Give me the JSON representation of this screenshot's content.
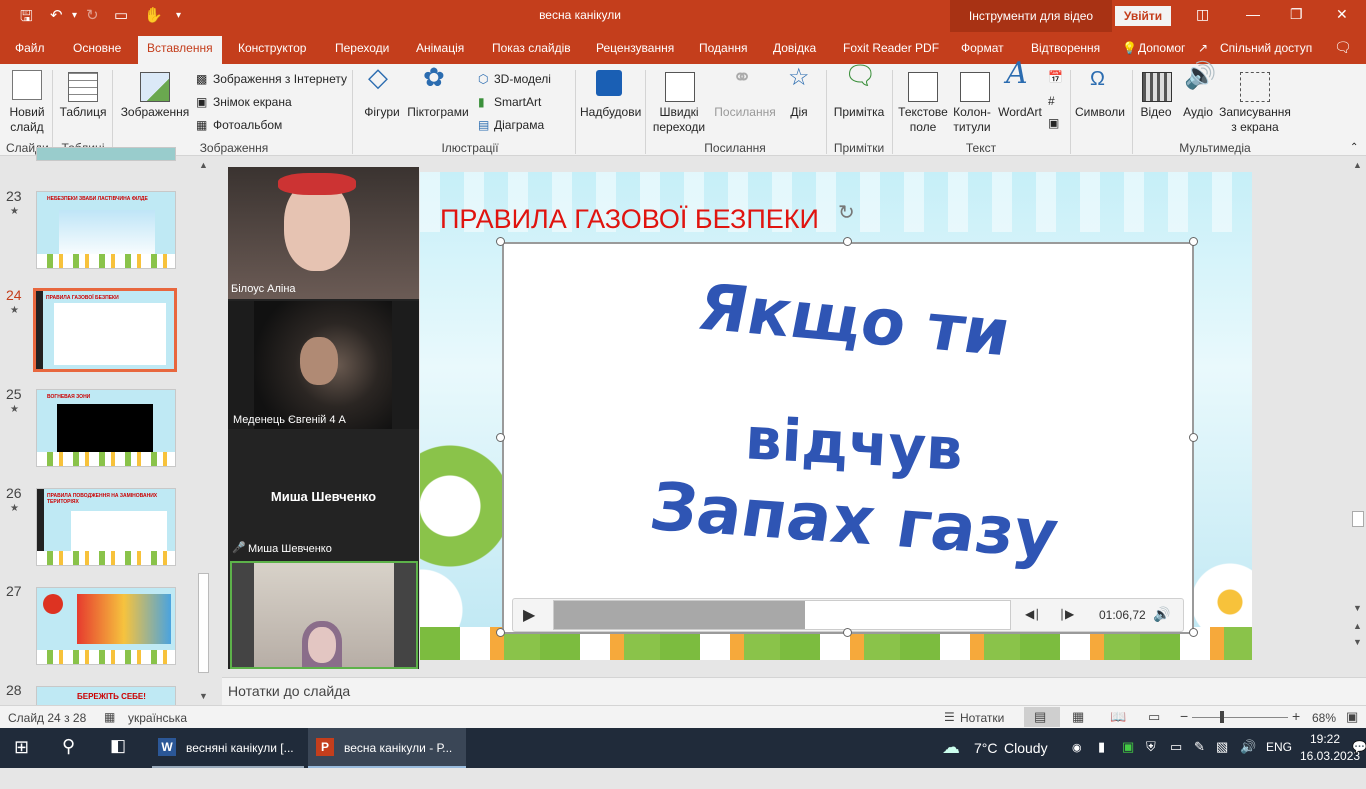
{
  "titlebar": {
    "doc_title": "весна канікули",
    "context_tools": "Інструменти для відео",
    "signin": "Увійти"
  },
  "tabs": [
    "Файл",
    "Основне",
    "Вставлення",
    "Конструктор",
    "Переходи",
    "Анімація",
    "Показ слайдів",
    "Рецензування",
    "Подання",
    "Довідка",
    "Foxit Reader PDF",
    "Формат",
    "Відтворення"
  ],
  "tabs_right": {
    "help": "Допомог",
    "share": "Спільний доступ"
  },
  "ribbon": {
    "new_slide": "Новий\nслайд",
    "table": "Таблиця",
    "images": "Зображення",
    "online_images": "Зображення з Інтернету",
    "screenshot": "Знімок екрана",
    "photo_album": "Фотоальбом",
    "shapes": "Фігури",
    "icons": "Піктограми",
    "models_3d": "3D-моделі",
    "smartart": "SmartArt",
    "chart": "Діаграма",
    "addins": "Надбудови",
    "zoom": "Швидкі\nпереходи",
    "link": "Посилання",
    "action": "Дія",
    "comment": "Примітка",
    "textbox": "Текстове\nполе",
    "header_footer": "Колон-\nтитули",
    "wordart": "WordArt",
    "symbols": "Символи",
    "video": "Відео",
    "audio": "Аудіо",
    "screen_rec": "Записування\nз екрана",
    "groups": {
      "slides": "Слайди",
      "tables": "Таблиці",
      "images": "Зображення",
      "illustrations": "Ілюстрації",
      "links": "Посилання",
      "comments": "Примітки",
      "text": "Текст",
      "media": "Мультимедіа"
    }
  },
  "slides": [
    {
      "num": "23",
      "title": "НЕБЕЗПЕКИ ЗВАБИ ЛАСТІВЧИНА ФІЛДЕ"
    },
    {
      "num": "24",
      "title": "ПРАВИЛА ГАЗОВОЇ БЕЗПЕКИ"
    },
    {
      "num": "25",
      "title": "ВОГНЕВАЯ ЗОНИ"
    },
    {
      "num": "26",
      "title": "ПРАВИЛА ПОВОДЖЕННЯ НА ЗАМІНОВАНИХ ТЕРИТОРІЯХ"
    },
    {
      "num": "27",
      "title": ""
    },
    {
      "num": "28",
      "title": "БЕРЕЖІТЬ СЕБЕ!"
    }
  ],
  "participants": [
    {
      "name": "Білоус Аліна"
    },
    {
      "name": "Меденець Євгеній 4 А"
    },
    {
      "name": "Миша Шевченко"
    },
    {
      "name": "Миша Шевченко"
    }
  ],
  "slide": {
    "title": "ПРАВИЛА ГАЗОВОЇ БЕЗПЕКИ",
    "video_line1": "Якщо ти",
    "video_line2": "відчув",
    "video_line3": "Запах газу",
    "video_time": "01:06,72",
    "video_progress": 0.55
  },
  "notes_placeholder": "Нотатки до слайда",
  "status": {
    "slide_info": "Слайд 24 з 28",
    "language": "українська",
    "notes": "Нотатки",
    "zoom": "68%"
  },
  "taskbar": {
    "word_task": "весняні канікули [...",
    "ppt_task": "весна канікули - Р...",
    "weather_temp": "7°C",
    "weather_desc": "Cloudy",
    "lang": "ENG",
    "time": "19:22",
    "date": "16.03.2023"
  },
  "colors": {
    "accent": "#c43e1c",
    "slide_title": "#e0140f",
    "video_text": "#2f55b4"
  }
}
